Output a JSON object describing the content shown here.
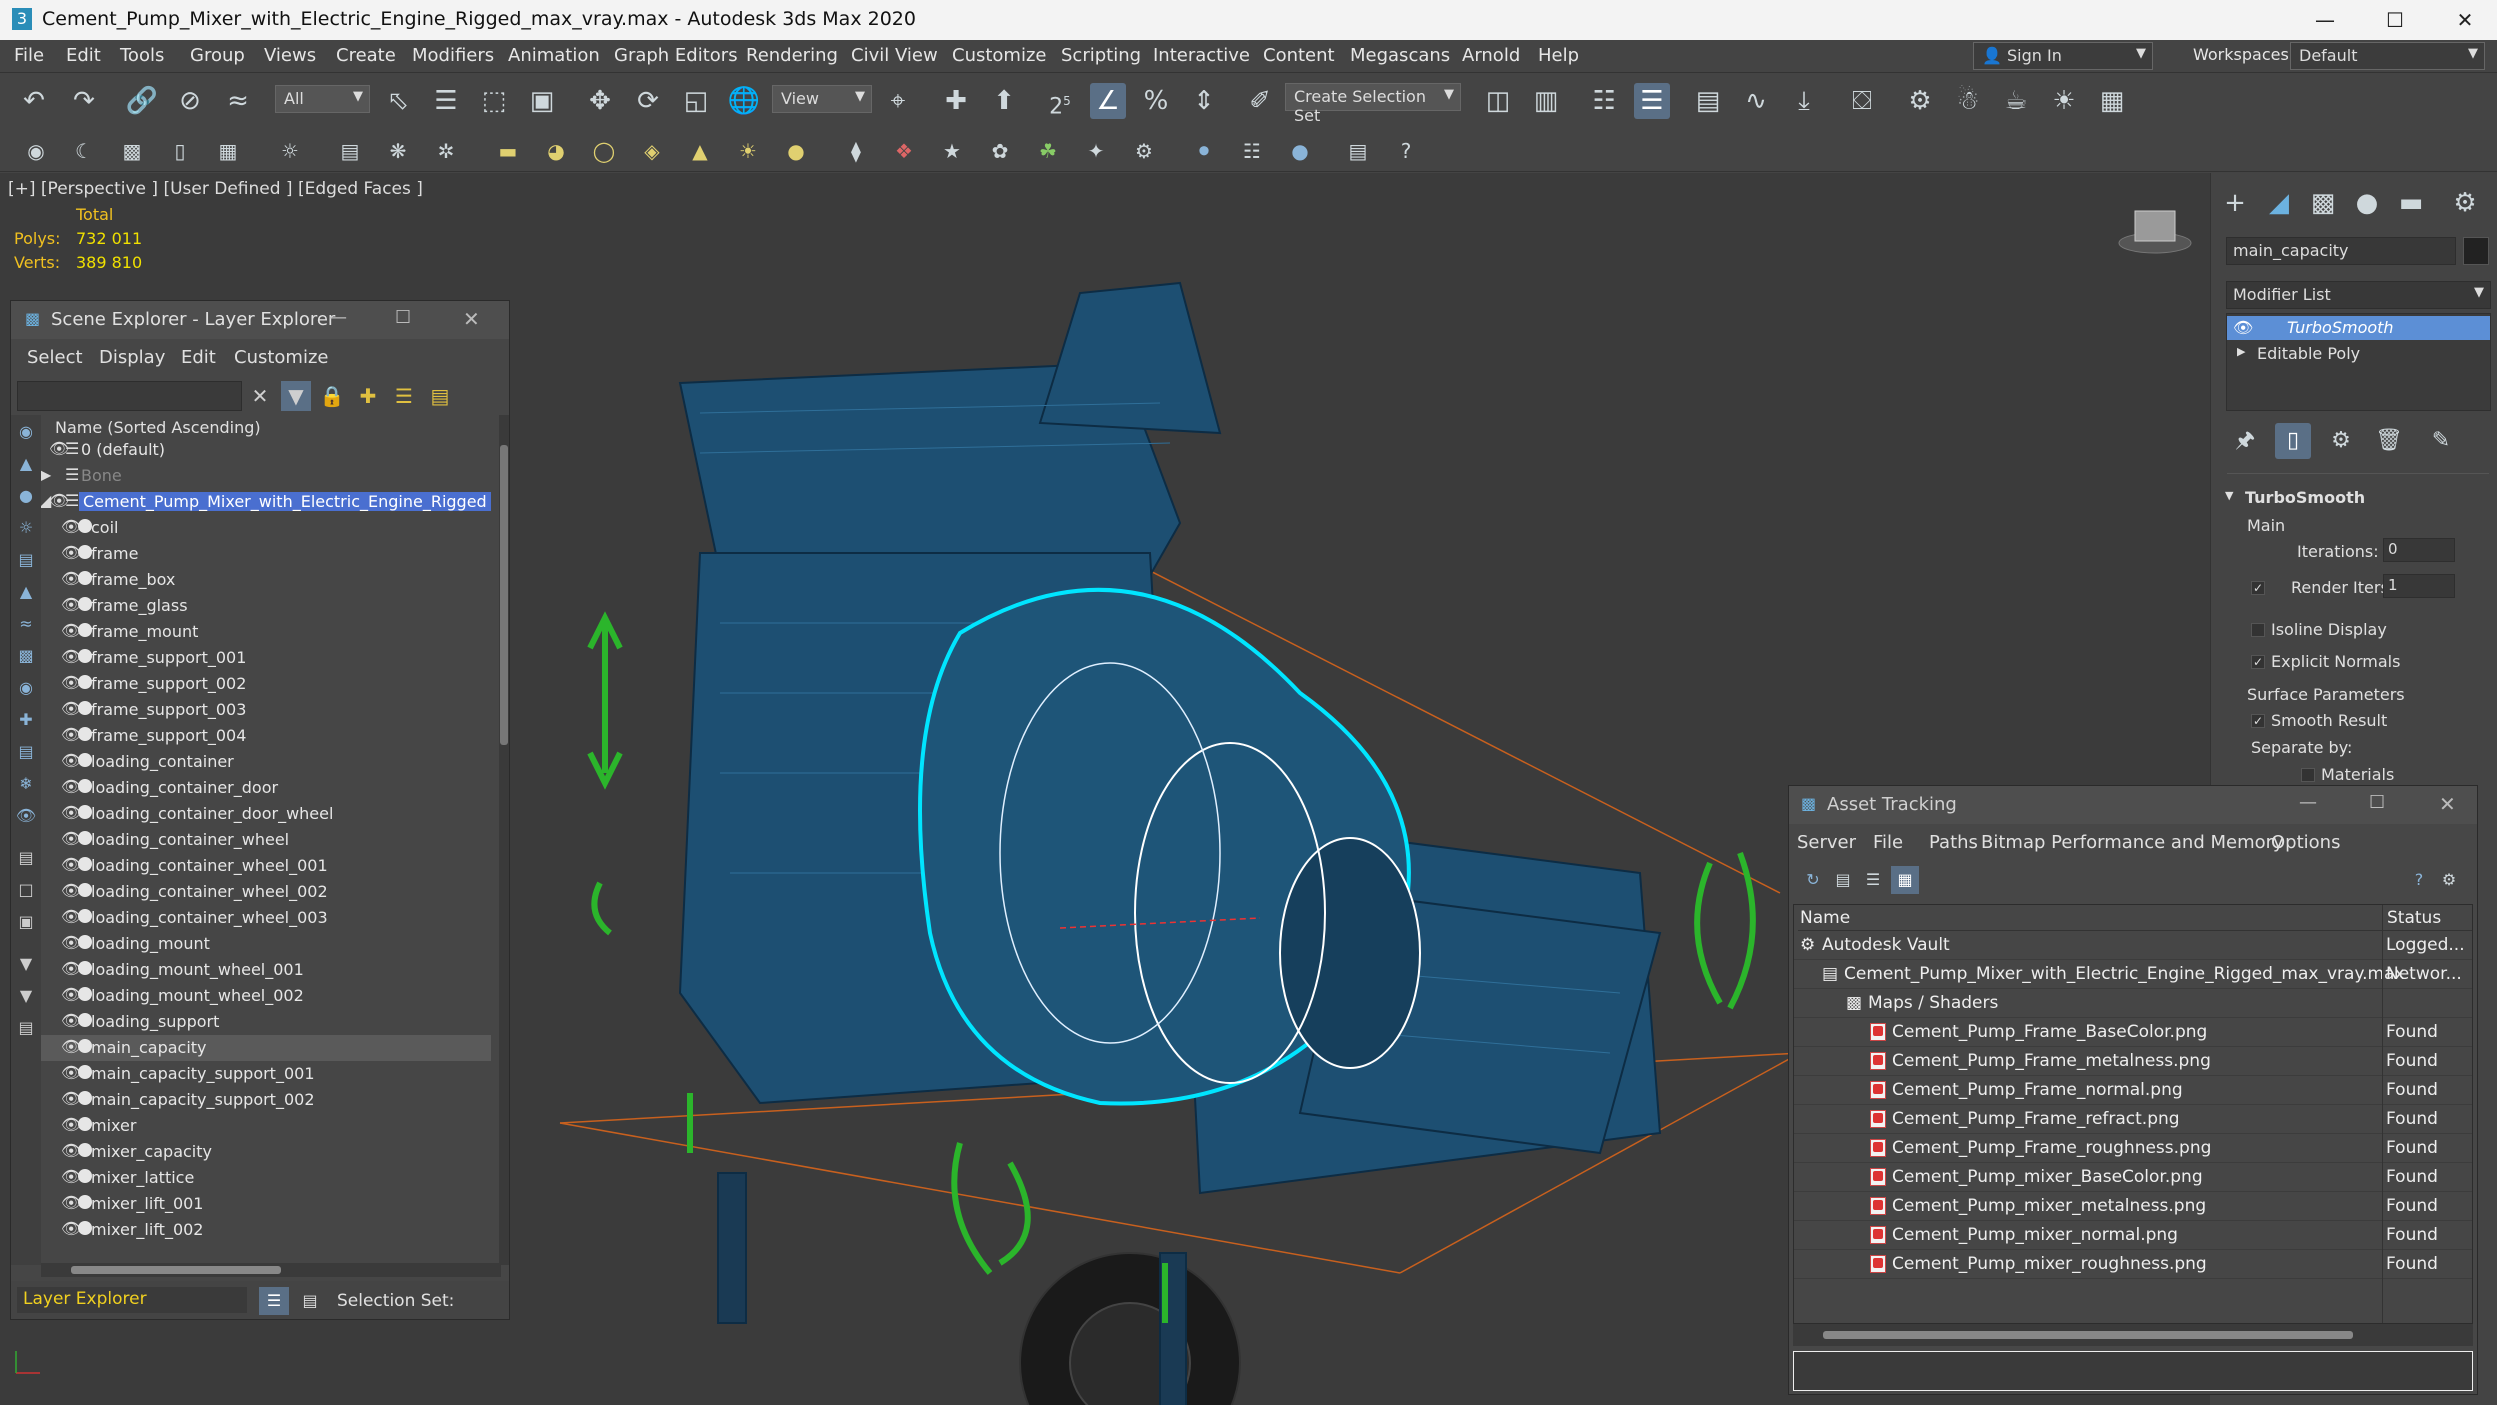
{
  "window": {
    "title": "Cement_Pump_Mixer_with_Electric_Engine_Rigged_max_vray.max - Autodesk 3ds Max 2020",
    "app_icon": "3"
  },
  "menu": [
    "File",
    "Edit",
    "Tools",
    "Group",
    "Views",
    "Create",
    "Modifiers",
    "Animation",
    "Graph Editors",
    "Rendering",
    "Civil View",
    "Customize",
    "Scripting",
    "Interactive",
    "Content",
    "Megascans",
    "Arnold",
    "Help"
  ],
  "account": {
    "sign_in": "Sign In",
    "workspaces_label": "Workspaces:",
    "workspace_value": "Default"
  },
  "toolbar": {
    "filter_dropdown": "All",
    "view_dropdown": "View",
    "selection_set": "Create Selection Set",
    "snap_label": "2",
    "snap_sub": "5"
  },
  "viewport": {
    "label": "[+] [Perspective ] [User Defined ] [Edged Faces ]",
    "stats_header": "Total",
    "polys_label": "Polys:",
    "polys_value": "732 011",
    "verts_label": "Verts:",
    "verts_value": "389 810",
    "accent": "#00e5ff",
    "gizmo_color": "#2bb52b"
  },
  "scene_explorer": {
    "title": "Scene Explorer - Layer Explorer",
    "menu": [
      "Select",
      "Display",
      "Edit",
      "Customize"
    ],
    "column_header": "Name (Sorted Ascending)",
    "layers": [
      {
        "label": "0 (default)"
      },
      {
        "label": "Bone"
      },
      {
        "label": "Cement_Pump_Mixer_with_Electric_Engine_Rigged"
      }
    ],
    "objects": [
      "coil",
      "frame",
      "frame_box",
      "frame_glass",
      "frame_mount",
      "frame_support_001",
      "frame_support_002",
      "frame_support_003",
      "frame_support_004",
      "loading_container",
      "loading_container_door",
      "loading_container_door_wheel",
      "loading_container_wheel",
      "loading_container_wheel_001",
      "loading_container_wheel_002",
      "loading_container_wheel_003",
      "loading_mount",
      "loading_mount_wheel_001",
      "loading_mount_wheel_002",
      "loading_support",
      "main_capacity",
      "main_capacity_support_001",
      "main_capacity_support_002",
      "mixer",
      "mixer_capacity",
      "mixer_lattice",
      "mixer_lift_001",
      "mixer_lift_002"
    ],
    "selected_object": "main_capacity",
    "footer_layer": "Layer Explorer",
    "footer_selection": "Selection Set:"
  },
  "command_panel": {
    "object_name": "main_capacity",
    "modifier_list": "Modifier List",
    "stack": [
      "TurboSmooth",
      "Editable Poly"
    ],
    "rollout_title": "TurboSmooth",
    "main_label": "Main",
    "iterations_label": "Iterations:",
    "iterations_value": "0",
    "render_iters_label": "Render Iters:",
    "render_iters_value": "1",
    "isoline_label": "Isoline Display",
    "explicit_label": "Explicit Normals",
    "surface_label": "Surface Parameters",
    "smooth_label": "Smooth Result",
    "separate_label": "Separate by:",
    "materials_label": "Materials"
  },
  "asset_tracking": {
    "title": "Asset Tracking",
    "menu": [
      "Server",
      "File",
      "Paths",
      "Bitmap Performance and Memory",
      "Options"
    ],
    "col_name": "Name",
    "col_status": "Status",
    "rows": [
      {
        "name": "Autodesk Vault",
        "status": "Logged..."
      },
      {
        "name": "Cement_Pump_Mixer_with_Electric_Engine_Rigged_max_vray.max",
        "status": "Networ..."
      },
      {
        "name": "Maps / Shaders",
        "status": ""
      },
      {
        "name": "Cement_Pump_Frame_BaseColor.png",
        "status": "Found"
      },
      {
        "name": "Cement_Pump_Frame_metalness.png",
        "status": "Found"
      },
      {
        "name": "Cement_Pump_Frame_normal.png",
        "status": "Found"
      },
      {
        "name": "Cement_Pump_Frame_refract.png",
        "status": "Found"
      },
      {
        "name": "Cement_Pump_Frame_roughness.png",
        "status": "Found"
      },
      {
        "name": "Cement_Pump_mixer_BaseColor.png",
        "status": "Found"
      },
      {
        "name": "Cement_Pump_mixer_metalness.png",
        "status": "Found"
      },
      {
        "name": "Cement_Pump_mixer_normal.png",
        "status": "Found"
      },
      {
        "name": "Cement_Pump_mixer_roughness.png",
        "status": "Found"
      }
    ]
  }
}
